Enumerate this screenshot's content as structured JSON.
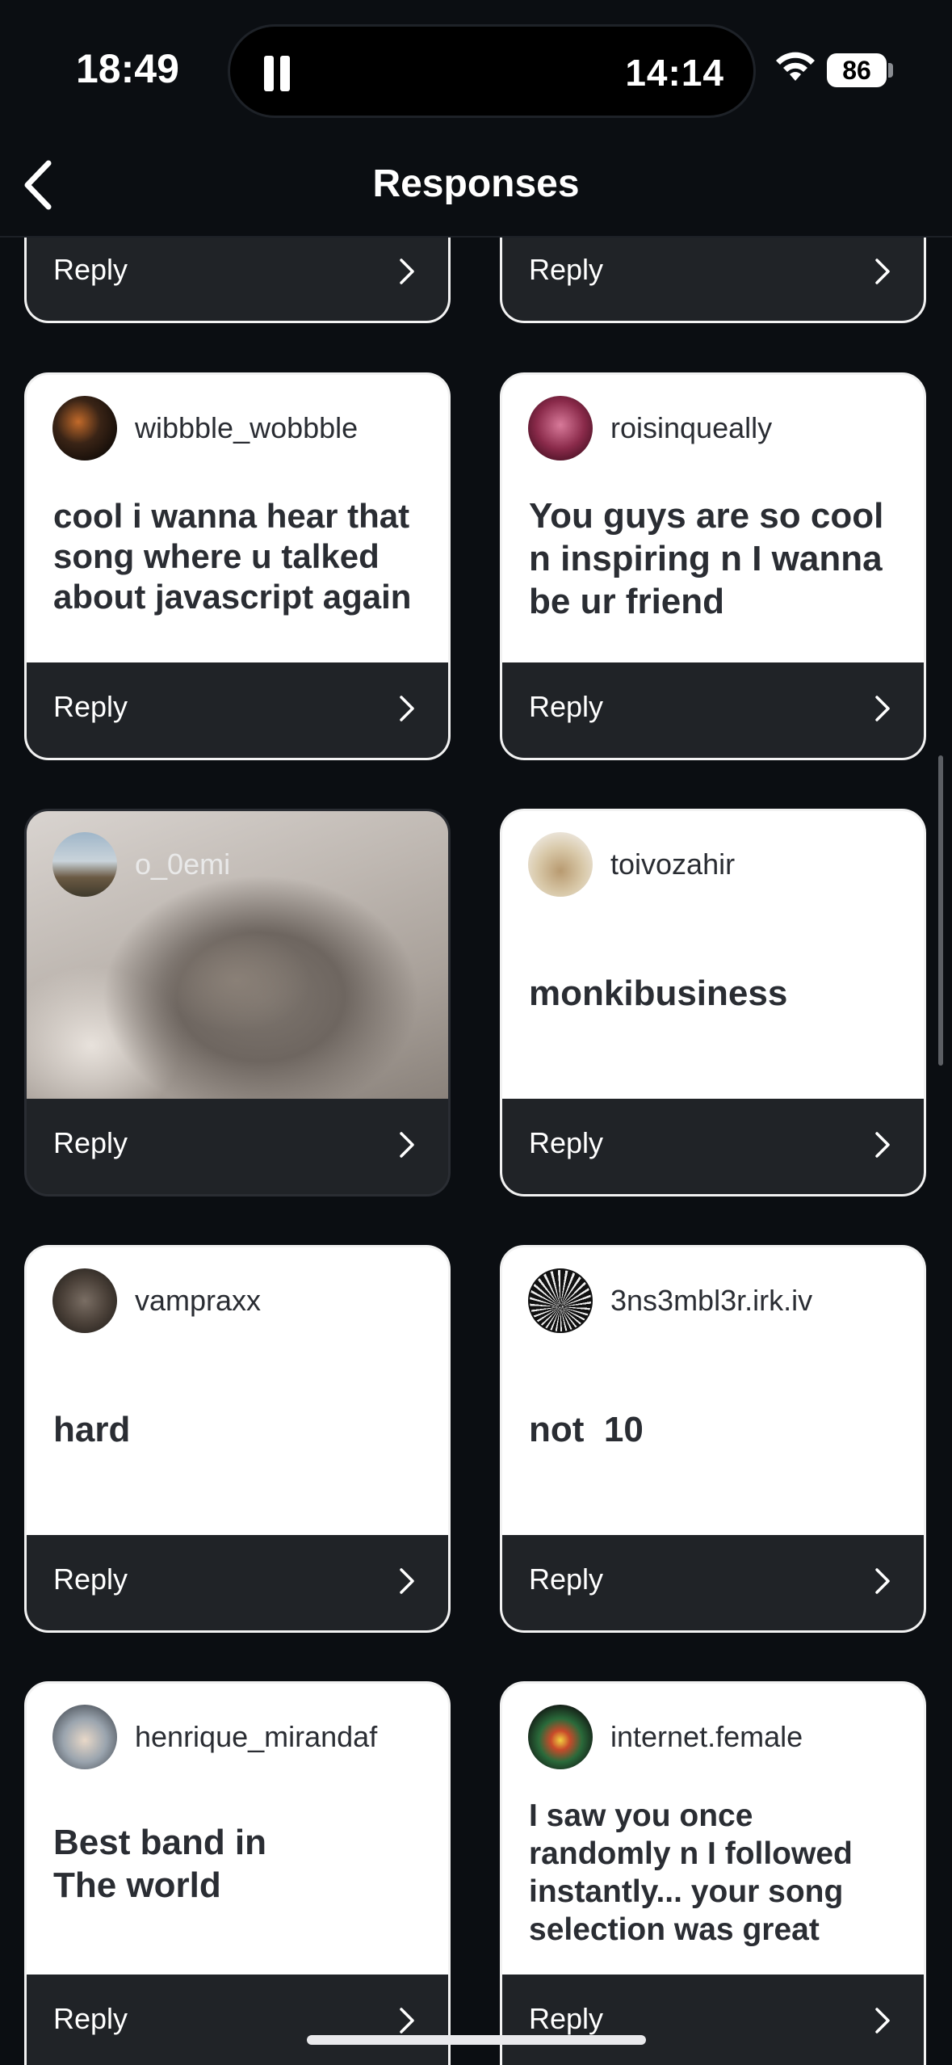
{
  "status_bar": {
    "time": "18:49",
    "timer": "14:14",
    "battery": "86"
  },
  "header": {
    "title": "Responses"
  },
  "reply_label": "Reply",
  "cards": [
    {
      "username": "wibbble_wobbble",
      "message": "cool  i wanna hear that song where u talked about javascript again"
    },
    {
      "username": "roisinqueally",
      "message": "You guys are so cool n inspiring n I wanna be ur friend"
    },
    {
      "username": "o_0emi",
      "message": ""
    },
    {
      "username": "toivozahir",
      "message": "monkibusiness"
    },
    {
      "username": "vampraxx",
      "message": "hard"
    },
    {
      "username": "3ns3mbl3r.irk.iv",
      "message": "not  10"
    },
    {
      "username": "henrique_mirandaf",
      "message": "Best band in The world"
    },
    {
      "username": "internet.female",
      "message": "I saw you once randomly n I followed instantly... your song selection was great"
    }
  ]
}
